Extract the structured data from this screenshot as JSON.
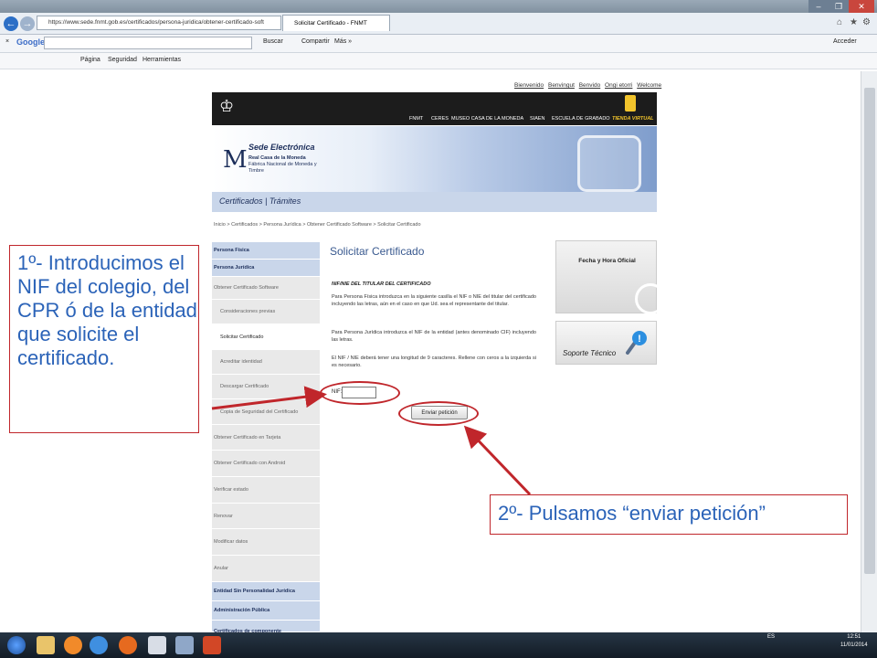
{
  "browser": {
    "url": "https://www.sede.fnmt.gob.es/certificados/persona-juridica/obtener-certificado-soft",
    "tab_title": "Solicitar Certificado - FNMT",
    "toolbar": {
      "google_label": "Google",
      "buscar": "Buscar",
      "compartir": "Compartir",
      "mas": "Más »",
      "acceder": "Acceder",
      "pagina": "Página",
      "seguridad": "Seguridad",
      "herramientas": "Herramientas"
    }
  },
  "site": {
    "lang_links": [
      "Bienvenido",
      "Benvingut",
      "Benvido",
      "Ongi etorri",
      "Welcome"
    ],
    "top_nav": [
      "FNMT",
      "CERES",
      "MUSEO CASA DE LA MONEDA",
      "SIAEN",
      "ESCUELA DE GRABADO",
      "TIENDA VIRTUAL"
    ],
    "banner": {
      "title": "Sede Electrónica",
      "sub1": "Real Casa de la Moneda",
      "sub2": "Fábrica Nacional de Moneda y Timbre",
      "nav": "Certificados  |  Trámites"
    },
    "breadcrumb": "Inicio  >  Certificados  >  Persona Jurídica  >  Obtener Certificado Software  >  Solicitar Certificado"
  },
  "menu": [
    {
      "label": "Persona Física"
    },
    {
      "label": "Persona Jurídica"
    },
    {
      "label": "Obtener Certificado Software"
    },
    {
      "label": "Consideraciones previas"
    },
    {
      "label": "Solicitar Certificado"
    },
    {
      "label": "Acreditar identidad"
    },
    {
      "label": "Descargar Certificado"
    },
    {
      "label": "Copia de Seguridad del Certificado"
    },
    {
      "label": "Obtener Certificado en Tarjeta"
    },
    {
      "label": "Obtener Certificado con Android"
    },
    {
      "label": "Verificar estado"
    },
    {
      "label": "Renovar"
    },
    {
      "label": "Modificar datos"
    },
    {
      "label": "Anular"
    },
    {
      "label": "Entidad Sin Personalidad Jurídica"
    },
    {
      "label": "Administración Pública"
    },
    {
      "label": "Certificados de componente"
    }
  ],
  "main": {
    "title": "Solicitar Certificado",
    "section": "NIF/NIE DEL TITULAR DEL CERTIFICADO",
    "p1": "Para Persona Física introduzca en la siguiente casilla el NIF o NIE del titular del certificado incluyendo las letras, aún en el caso en que Ud. sea el representante del titular.",
    "p2": "Para Persona Jurídica introduzca el NIF de la entidad (antes denominado CIF) incluyendo las letras.",
    "p3": "El NIF / NIE deberá tener una longitud de 9 caracteres. Rellene con ceros a la izquierda si es necesario.",
    "nif_label": "NIF:",
    "nif_value": "",
    "send_label": "Enviar petición"
  },
  "widgets": {
    "fecha": "Fecha y Hora Oficial",
    "soporte": "Soporte Técnico"
  },
  "annotations": {
    "note1": "1º- Introducimos el NIF del colegio, del CPR ó de la entidad que solicite el certificado.",
    "note2": "2º- Pulsamos “enviar petición”"
  },
  "taskbar": {
    "lang": "ES",
    "time": "12:51",
    "date": "11/01/2014"
  },
  "colors": {
    "annotation_red": "#c0262b",
    "annotation_blue": "#2b63b8",
    "menu_blue": "#c9d6ea",
    "title_blue": "#39598f"
  }
}
